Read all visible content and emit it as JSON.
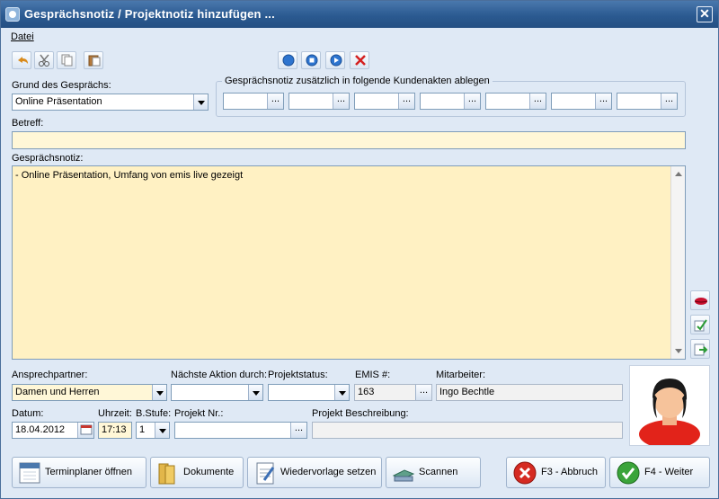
{
  "window": {
    "title": "Gesprächsnotiz / Projektnotiz hinzufügen ...",
    "close_glyph": "✕"
  },
  "menu": {
    "datei": "Datei"
  },
  "toolbar": {
    "left_icons": [
      "undo-icon",
      "scissors-icon",
      "copy-icon",
      "paste-icon"
    ],
    "center_icons": [
      "record-icon",
      "stop-icon",
      "play-icon",
      "delete-x-icon"
    ]
  },
  "grund": {
    "label": "Grund des Gesprächs:",
    "value": "Online Präsentation"
  },
  "kundenakten": {
    "label": "Gesprächsnotiz zusätzlich in folgende Kundenakten ablegen",
    "values": [
      "",
      "",
      "",
      "",
      "",
      "",
      ""
    ],
    "button_label": "..."
  },
  "betreff": {
    "label": "Betreff:",
    "value": ""
  },
  "notiz": {
    "label": "Gesprächsnotiz:",
    "value": "- Online Präsentation, Umfang von emis live gezeigt"
  },
  "side_tools": [
    "lips-icon",
    "spellcheck-icon",
    "export-icon"
  ],
  "ansprechpartner": {
    "label": "Ansprechpartner:",
    "value": "Damen und Herren"
  },
  "naechste_aktion": {
    "label": "Nächste Aktion durch:",
    "value": ""
  },
  "projektstatus": {
    "label": "Projektstatus:",
    "value": ""
  },
  "emis": {
    "label": "EMIS #:",
    "value": "163",
    "button_label": "..."
  },
  "mitarbeiter": {
    "label": "Mitarbeiter:",
    "value": "Ingo Bechtle"
  },
  "datum": {
    "label": "Datum:",
    "value": "18.04.2012"
  },
  "uhrzeit": {
    "label": "Uhrzeit:",
    "value": "17:13"
  },
  "bstufe": {
    "label": "B.Stufe:",
    "value": "1"
  },
  "projekt_nr": {
    "label": "Projekt Nr.:",
    "value": "",
    "button_label": "..."
  },
  "projekt_beschreibung": {
    "label": "Projekt Beschreibung:",
    "value": ""
  },
  "buttons": {
    "terminplaner": "Terminplaner öffnen",
    "dokumente": "Dokumente",
    "wiedervorlage": "Wiedervorlage setzen",
    "scannen": "Scannen",
    "abbruch": "F3 - Abbruch",
    "weiter": "F4 - Weiter"
  },
  "colors": {
    "titlebar": "#2b5a91",
    "window_bg": "#dfe9f5",
    "yellow_field": "#fff7d7",
    "memo_bg": "#fff1c3"
  }
}
